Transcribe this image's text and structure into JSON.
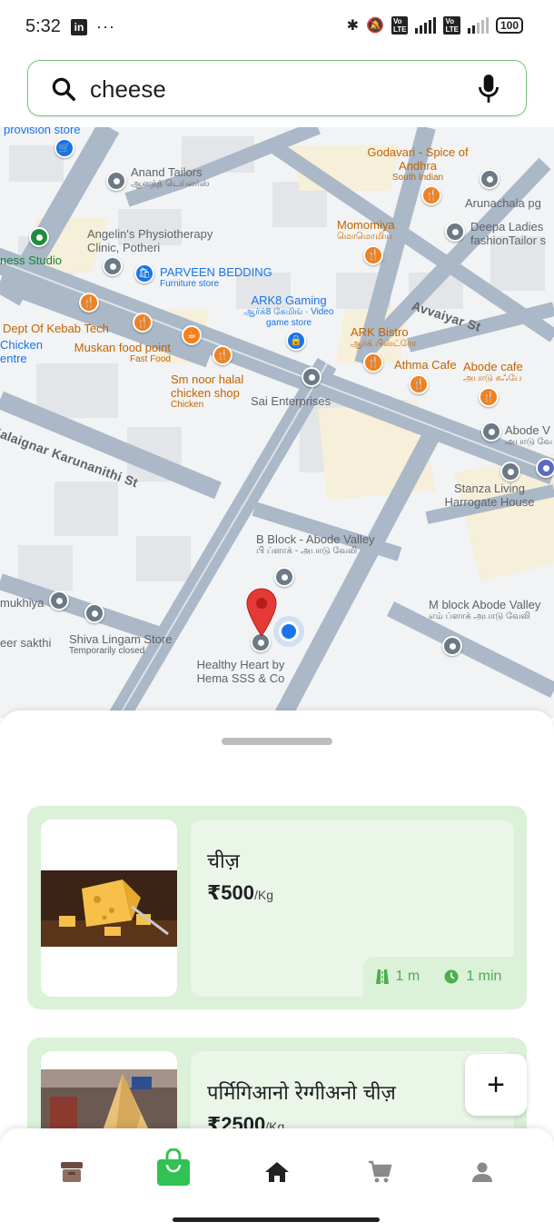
{
  "status_bar": {
    "time": "5:32",
    "left_icons": [
      "linkedin-icon",
      "more-dots-icon"
    ],
    "network_label_1": "5G",
    "volte_label": "Vo LTE",
    "battery": "100"
  },
  "search": {
    "value": "cheese",
    "icon": "search-icon",
    "voice_icon": "microphone-icon"
  },
  "map": {
    "streets": [
      "Avvaiyar St",
      "Kalaignar Karunanithi St"
    ],
    "places": [
      {
        "name": "provision store",
        "sub": ""
      },
      {
        "name": "Anand Tailors",
        "sub": "ஆனந்த் டெய்லர்ஸ்"
      },
      {
        "name": "Godavari - Spice of Andhra",
        "sub": "South Indian"
      },
      {
        "name": "Arunachala pg",
        "sub": ""
      },
      {
        "name": "Angelin's Physiotherapy Clinic, Potheri",
        "sub": ""
      },
      {
        "name": "Momomiya",
        "sub": "மொமொமிய"
      },
      {
        "name": "Deepa Ladies fashionTailor s",
        "sub": ""
      },
      {
        "name": "ness Studio",
        "sub": ""
      },
      {
        "name": "PARVEEN BEDDING",
        "sub": "Furniture store"
      },
      {
        "name": "ARK8 Gaming",
        "sub": "ஆர்க்8 கேமிங் · Video game store"
      },
      {
        "name": "Dept Of Kebab Tech",
        "sub": ""
      },
      {
        "name": "Muskan food point",
        "sub": "Fast Food"
      },
      {
        "name": "ARK Bistro",
        "sub": "ஆர்க் பிஸ்ட்ரோ"
      },
      {
        "name": "Athma Cafe",
        "sub": ""
      },
      {
        "name": "Abode cafe",
        "sub": "அபாடு கஃபே"
      },
      {
        "name": "Chicken entre",
        "sub": ""
      },
      {
        "name": "Sm noor halal chicken shop",
        "sub": "Chicken"
      },
      {
        "name": "Sai Enterprises",
        "sub": ""
      },
      {
        "name": "Abode V",
        "sub": "அபாடு வே"
      },
      {
        "name": "Stanza Living Harrogate House",
        "sub": ""
      },
      {
        "name": "B Block - Abode Valley",
        "sub": "பி ப்ளாக் - அபாடு வேலி"
      },
      {
        "name": "mukhiya",
        "sub": ""
      },
      {
        "name": "Shiva Lingam Store",
        "sub": "Temporarily closed"
      },
      {
        "name": "eer sakthi",
        "sub": ""
      },
      {
        "name": "M block Abode Valley",
        "sub": "எம் ப்ளாக் அபாடு வேலி"
      },
      {
        "name": "Healthy Heart by Hema SSS & Co",
        "sub": ""
      }
    ]
  },
  "products": [
    {
      "name": "चीज़",
      "price": "₹500",
      "unit": "/Kg",
      "distance": "1 m",
      "time": "1 min"
    },
    {
      "name": "पर्मिगिआनो रेग्गीअनो चीज़",
      "price": "₹2500",
      "unit": "/Kg"
    }
  ],
  "add_button_label": "+",
  "nav": {
    "items": [
      "orders-icon",
      "shopping-bag-icon",
      "home-icon",
      "cart-icon",
      "profile-icon"
    ],
    "active": "shopping-bag-icon",
    "accent": "#34c153"
  },
  "colors": {
    "card_bg": "#dbf1d8",
    "accent_green": "#4caf50",
    "search_border": "#7cc47e"
  }
}
